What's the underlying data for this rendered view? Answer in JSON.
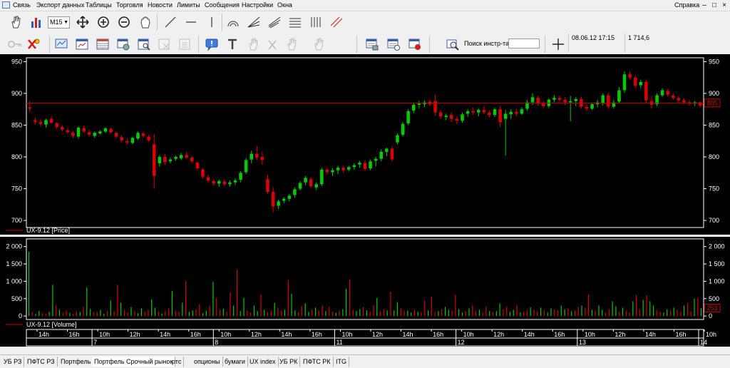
{
  "menu": {
    "items": [
      "Связь",
      "Экспорт данных",
      "Таблицы",
      "Торговля",
      "Новости",
      "Лимиты",
      "Сообщения",
      "Настройки",
      "Окна"
    ],
    "help": "Справка",
    "window_controls": [
      "–",
      "□",
      "×"
    ]
  },
  "toolbar": {
    "interval_value": "M15",
    "search_label": "Поиск инстр-та",
    "search_value": "",
    "cursor_datetime": "08.06.12 17:15",
    "cursor_value": "1 714,6",
    "icons": [
      "hand-icon",
      "bar-chart-icon",
      "move-cross-icon",
      "zoom-in-icon",
      "zoom-out-icon",
      "grab-hand-icon",
      "trend-line-icon",
      "horizontal-line-icon",
      "vertical-line-icon",
      "arc-icon",
      "fan-icon",
      "channel-icon",
      "cycle-lines-icon",
      "parallel-lines-icon",
      "key-icon",
      "delete-icon",
      "monitor-icon",
      "chart-window-icon",
      "table-icon",
      "portfolio-icon",
      "search-doc-icon",
      "doc-icon",
      "doc2-icon",
      "alert-icon",
      "text-tool-icon",
      "hand-tool-icon",
      "cross-tool-icon",
      "hand-tool2-icon",
      "hand-tool3-icon",
      "orders-icon",
      "trades-icon",
      "stop-orders-icon",
      "find-instrument-icon",
      "crosshair-icon"
    ]
  },
  "colors": {
    "up": "#00cc00",
    "down": "#dd0000",
    "priceline": "#cc0000",
    "axis": "#ffffff",
    "background": "#000000"
  },
  "chart_data": [
    {
      "type": "candlestick",
      "legend": "UX-9.12 [Price]",
      "ylim": [
        690,
        955
      ],
      "y_ticks": [
        700,
        750,
        800,
        850,
        900,
        950
      ],
      "last_price_label": "885",
      "last_price_line": 885,
      "candles": [
        [
          878,
          888,
          870,
          876
        ],
        [
          858,
          862,
          851,
          855
        ],
        [
          855,
          859,
          848,
          852
        ],
        [
          851,
          860,
          846,
          858
        ],
        [
          860,
          864,
          852,
          854
        ],
        [
          853,
          855,
          844,
          847
        ],
        [
          847,
          850,
          840,
          843
        ],
        [
          842,
          846,
          836,
          839
        ],
        [
          838,
          841,
          830,
          833
        ],
        [
          832,
          848,
          829,
          846
        ],
        [
          845,
          849,
          838,
          840
        ],
        [
          839,
          843,
          832,
          835
        ],
        [
          833,
          840,
          830,
          838
        ],
        [
          837,
          842,
          835,
          840
        ],
        [
          840,
          847,
          838,
          845
        ],
        [
          844,
          846,
          837,
          839
        ],
        [
          838,
          840,
          829,
          832
        ],
        [
          831,
          834,
          823,
          826
        ],
        [
          825,
          829,
          820,
          823
        ],
        [
          822,
          832,
          820,
          830
        ],
        [
          829,
          840,
          827,
          838
        ],
        [
          837,
          840,
          830,
          833
        ],
        [
          832,
          835,
          824,
          826
        ],
        [
          820,
          836,
          750,
          770
        ],
        [
          790,
          803,
          785,
          800
        ],
        [
          800,
          805,
          788,
          792
        ],
        [
          793,
          799,
          790,
          796
        ],
        [
          797,
          802,
          794,
          800
        ],
        [
          798,
          806,
          795,
          803
        ],
        [
          803,
          808,
          797,
          799
        ],
        [
          799,
          801,
          790,
          793
        ],
        [
          791,
          793,
          779,
          782
        ],
        [
          780,
          782,
          766,
          769
        ],
        [
          768,
          772,
          760,
          763
        ],
        [
          762,
          765,
          755,
          758
        ],
        [
          758,
          764,
          753,
          762
        ],
        [
          761,
          764,
          755,
          757
        ],
        [
          757,
          763,
          753,
          760
        ],
        [
          760,
          766,
          756,
          763
        ],
        [
          764,
          778,
          760,
          775
        ],
        [
          776,
          798,
          773,
          795
        ],
        [
          796,
          810,
          790,
          805
        ],
        [
          805,
          817,
          795,
          799
        ],
        [
          800,
          808,
          788,
          795
        ],
        [
          765,
          772,
          742,
          745
        ],
        [
          745,
          752,
          713,
          722
        ],
        [
          723,
          733,
          718,
          730
        ],
        [
          731,
          737,
          727,
          734
        ],
        [
          734,
          742,
          730,
          739
        ],
        [
          740,
          752,
          736,
          749
        ],
        [
          750,
          762,
          747,
          759
        ],
        [
          760,
          770,
          755,
          767
        ],
        [
          765,
          768,
          751,
          754
        ],
        [
          752,
          760,
          748,
          757
        ],
        [
          757,
          783,
          754,
          780
        ],
        [
          780,
          783,
          772,
          776
        ],
        [
          776,
          782,
          770,
          779
        ],
        [
          779,
          786,
          773,
          783
        ],
        [
          783,
          786,
          775,
          779
        ],
        [
          780,
          786,
          777,
          784
        ],
        [
          784,
          790,
          780,
          787
        ],
        [
          788,
          794,
          783,
          791
        ],
        [
          790,
          795,
          778,
          781
        ],
        [
          782,
          796,
          779,
          793
        ],
        [
          794,
          800,
          785,
          797
        ],
        [
          797,
          812,
          793,
          808
        ],
        [
          808,
          815,
          801,
          813
        ],
        [
          813,
          817,
          793,
          796
        ],
        [
          823,
          837,
          820,
          834
        ],
        [
          835,
          855,
          832,
          852
        ],
        [
          853,
          875,
          850,
          872
        ],
        [
          873,
          885,
          869,
          882
        ],
        [
          882,
          888,
          876,
          884
        ],
        [
          883,
          889,
          878,
          886
        ],
        [
          887,
          890,
          880,
          883
        ],
        [
          888,
          898,
          865,
          870
        ],
        [
          870,
          873,
          860,
          864
        ],
        [
          863,
          868,
          858,
          865
        ],
        [
          866,
          870,
          855,
          860
        ],
        [
          860,
          864,
          852,
          857
        ],
        [
          857,
          870,
          854,
          867
        ],
        [
          868,
          875,
          863,
          872
        ],
        [
          872,
          878,
          866,
          870
        ],
        [
          870,
          876,
          864,
          874
        ],
        [
          874,
          880,
          867,
          870
        ],
        [
          870,
          873,
          862,
          866
        ],
        [
          866,
          877,
          863,
          875
        ],
        [
          875,
          880,
          848,
          855
        ],
        [
          860,
          874,
          802,
          868
        ],
        [
          867,
          875,
          860,
          871
        ],
        [
          871,
          876,
          864,
          868
        ],
        [
          868,
          878,
          866,
          875
        ],
        [
          876,
          890,
          873,
          886
        ],
        [
          886,
          900,
          882,
          894
        ],
        [
          893,
          896,
          881,
          884
        ],
        [
          884,
          888,
          877,
          880
        ],
        [
          880,
          892,
          877,
          890
        ],
        [
          890,
          897,
          886,
          893
        ],
        [
          893,
          896,
          887,
          890
        ],
        [
          890,
          894,
          882,
          886
        ],
        [
          886,
          896,
          856,
          888
        ],
        [
          888,
          894,
          880,
          891
        ],
        [
          891,
          895,
          876,
          879
        ],
        [
          879,
          883,
          872,
          876
        ],
        [
          876,
          885,
          874,
          883
        ],
        [
          883,
          890,
          878,
          886
        ],
        [
          884,
          900,
          881,
          897
        ],
        [
          897,
          901,
          876,
          879
        ],
        [
          879,
          890,
          876,
          886
        ],
        [
          887,
          910,
          884,
          905
        ],
        [
          905,
          935,
          901,
          930
        ],
        [
          930,
          935,
          922,
          925
        ],
        [
          925,
          928,
          908,
          912
        ],
        [
          913,
          922,
          908,
          918
        ],
        [
          918,
          922,
          885,
          889
        ],
        [
          888,
          896,
          876,
          882
        ],
        [
          883,
          900,
          880,
          897
        ],
        [
          897,
          908,
          894,
          905
        ],
        [
          904,
          907,
          895,
          898
        ],
        [
          897,
          900,
          890,
          893
        ],
        [
          893,
          896,
          886,
          889
        ],
        [
          889,
          892,
          883,
          886
        ],
        [
          886,
          889,
          881,
          884
        ],
        [
          884,
          888,
          880,
          886
        ],
        [
          886,
          887,
          878,
          881
        ]
      ]
    },
    {
      "type": "bar",
      "legend": "UX-9.12 [Volume]",
      "ylim": [
        -80,
        2200
      ],
      "y_ticks": [
        0,
        500,
        1000,
        1500,
        2000
      ],
      "y_tick_labels": [
        "0",
        "500",
        "1 000",
        "1 500",
        "2 000"
      ],
      "last_value_label": "253",
      "values": [
        1850,
        120,
        60,
        150,
        80,
        60,
        120,
        900,
        300,
        180,
        100,
        160,
        90,
        60,
        140,
        120,
        260,
        820,
        200,
        100,
        120,
        180,
        60,
        150,
        450,
        140,
        900,
        380,
        180,
        100,
        260,
        140,
        80,
        220,
        120,
        180,
        480,
        240,
        130,
        70,
        140,
        220,
        720,
        160,
        120,
        380,
        1000,
        120,
        160,
        200,
        340,
        80,
        150,
        300,
        980,
        520,
        180,
        210,
        120,
        680,
        300,
        1340,
        140,
        520,
        160,
        100,
        300,
        140,
        620,
        180,
        120,
        160,
        380,
        240,
        150,
        180,
        1040,
        640,
        160,
        100,
        280,
        360,
        120,
        180,
        240,
        160,
        300,
        140,
        260,
        120,
        90,
        160,
        200,
        780,
        1050,
        180,
        140,
        200,
        250,
        160,
        120,
        300,
        520,
        140,
        200,
        160,
        700,
        160,
        400,
        220,
        160,
        160,
        100,
        180,
        120,
        100,
        440,
        160,
        560,
        120,
        140,
        200,
        260,
        180,
        160,
        600,
        200,
        100,
        140,
        220,
        300,
        140,
        180,
        100,
        260,
        140,
        120,
        140,
        360,
        200,
        260,
        120,
        180,
        320,
        100,
        130,
        160,
        250,
        180,
        140,
        240,
        160,
        100,
        220,
        190,
        170,
        300,
        200,
        220,
        140,
        160,
        260,
        300,
        240,
        620,
        180,
        160,
        300,
        180,
        100,
        200,
        420,
        280,
        120,
        240,
        160,
        100,
        420,
        600,
        180,
        460,
        600,
        420,
        300,
        160,
        120,
        100,
        200,
        160,
        240,
        180,
        120,
        300,
        380,
        140,
        500,
        520,
        230
      ]
    }
  ],
  "time_axis": {
    "hour_labels": [
      "14h",
      "16h",
      "10h",
      "12h",
      "14h",
      "16h",
      "10h",
      "12h",
      "14h",
      "16h",
      "10h",
      "12h",
      "14h",
      "16h",
      "10h",
      "12h",
      "14h",
      "16h",
      "10h",
      "12h",
      "14h",
      "16h",
      "10h"
    ],
    "day_labels": [
      "7",
      "8",
      "11",
      "12",
      "13",
      "14"
    ]
  },
  "status_tabs": [
    "УБ РЗ",
    "ПФТС РЗ",
    "Портфель",
    "Портфель Срочный рынок",
    "ртс",
    "опционы",
    "бумаги",
    "UX index",
    "УБ РК",
    "ПФТС РК",
    "ITG"
  ]
}
